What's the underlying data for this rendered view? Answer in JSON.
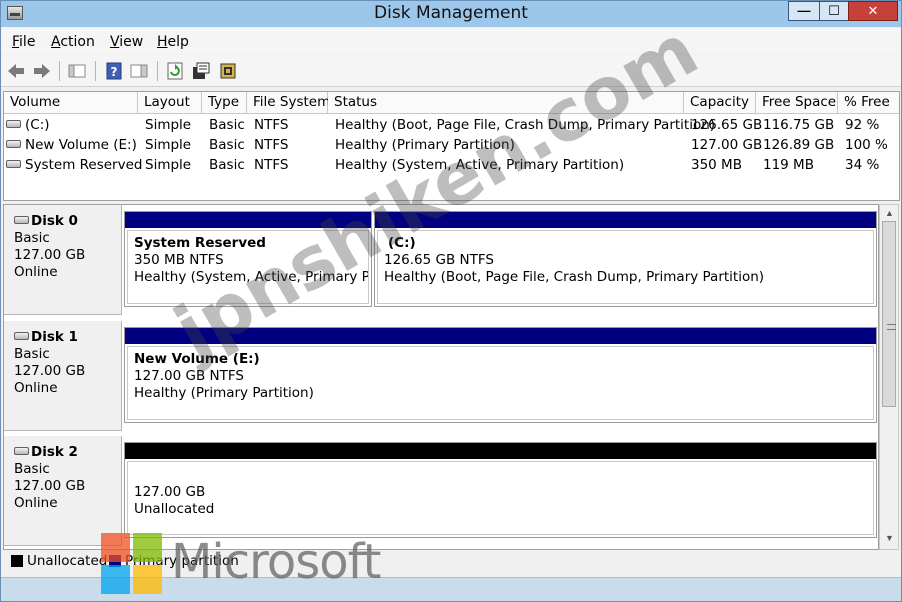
{
  "window": {
    "title": "Disk Management",
    "min_glyph": "—",
    "max_glyph": "☐",
    "close_glyph": "✕"
  },
  "menu": {
    "file": {
      "key": "F",
      "rest": "ile"
    },
    "action": {
      "key": "A",
      "rest": "ction"
    },
    "view": {
      "key": "V",
      "rest": "iew"
    },
    "help": {
      "key": "H",
      "rest": "elp"
    }
  },
  "toolbar": {
    "icons": [
      "back-arrow-icon",
      "forward-arrow-icon",
      "console-tree-icon",
      "help-icon",
      "properties-pane-icon",
      "refresh-icon",
      "properties-icon",
      "rescan-disks-icon"
    ]
  },
  "volume_list": {
    "columns": [
      "Volume",
      "Layout",
      "Type",
      "File System",
      "Status",
      "Capacity",
      "Free Space",
      "% Free"
    ],
    "rows": [
      {
        "volume": "(C:)",
        "layout": "Simple",
        "type": "Basic",
        "fs": "NTFS",
        "status": "Healthy (Boot, Page File, Crash Dump, Primary Partition)",
        "capacity": "126.65 GB",
        "free": "116.75 GB",
        "pct": "92 %"
      },
      {
        "volume": "New Volume (E:)",
        "layout": "Simple",
        "type": "Basic",
        "fs": "NTFS",
        "status": "Healthy (Primary Partition)",
        "capacity": "127.00 GB",
        "free": "126.89 GB",
        "pct": "100 %"
      },
      {
        "volume": "System Reserved",
        "layout": "Simple",
        "type": "Basic",
        "fs": "NTFS",
        "status": "Healthy (System, Active, Primary Partition)",
        "capacity": "350 MB",
        "free": "119 MB",
        "pct": "34 %"
      }
    ]
  },
  "disks": [
    {
      "name": "Disk 0",
      "type": "Basic",
      "size": "127.00 GB",
      "state": "Online",
      "partitions": [
        {
          "title": "System Reserved",
          "size": "350 MB NTFS",
          "status": "Healthy (System, Active, Primary Partit"
        },
        {
          "title": "(C:)",
          "size": "126.65 GB NTFS",
          "status": "Healthy (Boot, Page File, Crash Dump, Primary Partition)"
        }
      ]
    },
    {
      "name": "Disk 1",
      "type": "Basic",
      "size": "127.00 GB",
      "state": "Online",
      "partitions": [
        {
          "title": "New Volume  (E:)",
          "size": "127.00 GB NTFS",
          "status": "Healthy (Primary Partition)"
        }
      ]
    },
    {
      "name": "Disk 2",
      "type": "Basic",
      "size": "127.00 GB",
      "state": "Online",
      "partitions": [
        {
          "size": "127.00 GB",
          "status": "Unallocated"
        }
      ]
    }
  ],
  "legend": [
    {
      "label": "Unallocated",
      "color": "#000000"
    },
    {
      "label": "Primary partition",
      "color": "#000080"
    }
  ],
  "colors": {
    "primary_partition": "#000080",
    "unallocated": "#000000",
    "titlebar": "#9cc6ea"
  },
  "overlay": {
    "watermark": "jpnshiken.com",
    "brand": "Microsoft"
  }
}
